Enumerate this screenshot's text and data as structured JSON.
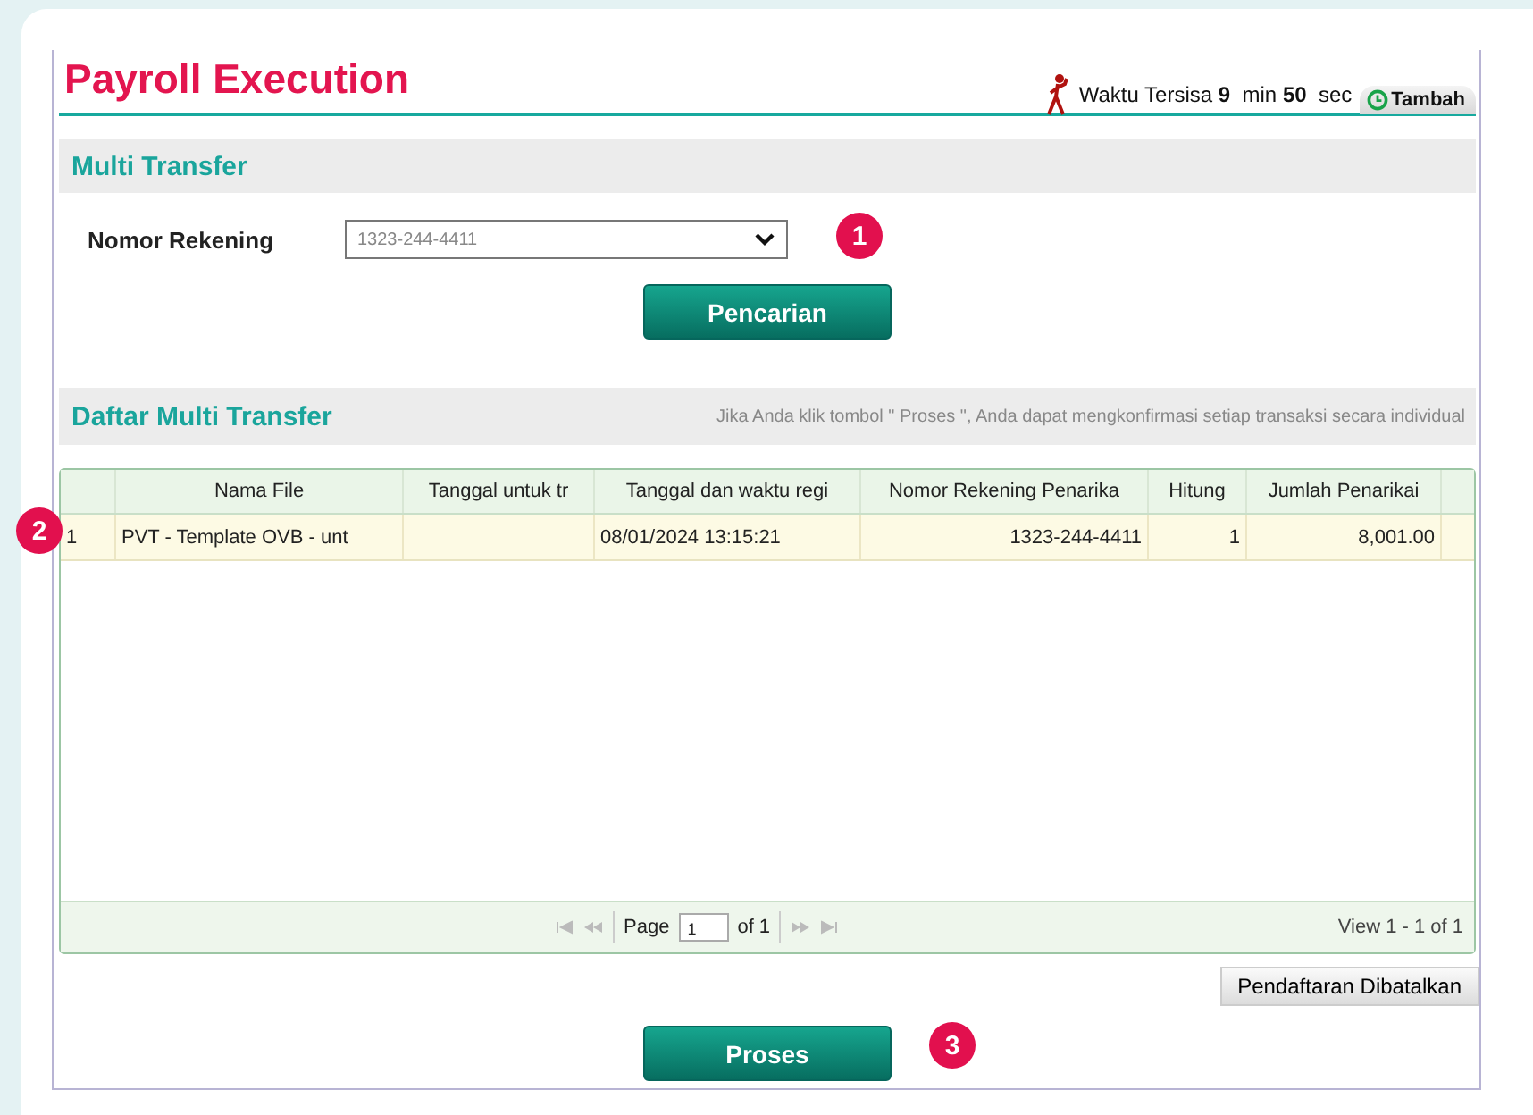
{
  "title": "Payroll Execution",
  "timer": {
    "label": "Waktu Tersisa",
    "minutes": "9",
    "min_unit": "min",
    "seconds": "50",
    "sec_unit": "sec",
    "extend_button": "Tambah"
  },
  "search_section": {
    "title": "Multi Transfer",
    "account_label": "Nomor Rekening",
    "account_value": "1323-244-4411",
    "search_button": "Pencarian"
  },
  "list_section": {
    "title": "Daftar Multi Transfer",
    "hint": "Jika Anda klik tombol \" Proses \", Anda dapat mengkonfirmasi setiap transaksi secara individual"
  },
  "table": {
    "columns": [
      "",
      "Nama File",
      "Tanggal untuk tr",
      "Tanggal dan waktu regi",
      "Nomor Rekening Penarika",
      "Hitung",
      "Jumlah Penarikai"
    ],
    "rows": [
      {
        "selected": true,
        "cells": [
          "1",
          "PVT - Template OVB - unt",
          "",
          "08/01/2024 13:15:21",
          "1323-244-4411",
          "1",
          "8,001.00"
        ]
      }
    ],
    "pager": {
      "page_label": "Page",
      "page": "1",
      "of_label": "of 1",
      "view": "View 1 - 1 of 1"
    }
  },
  "cancel_button": "Pendaftaran Dibatalkan",
  "process_button": "Proses",
  "step_markers": [
    "1",
    "2",
    "3"
  ]
}
